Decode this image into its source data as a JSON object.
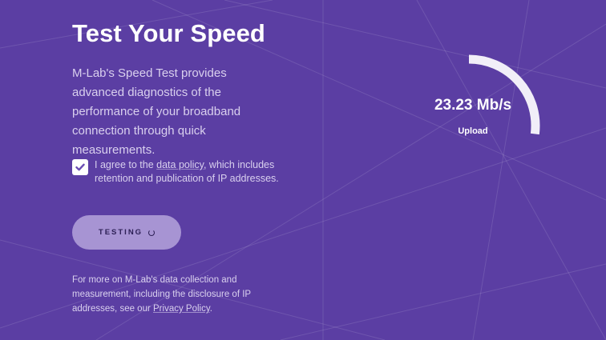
{
  "page": {
    "title": "Test Your Speed",
    "description": "M-Lab's Speed Test provides advanced diagnostics of the performance of your broadband connection through quick measurements."
  },
  "agreement": {
    "checked": true,
    "text_before": "I agree to the ",
    "link_text": "data policy",
    "text_after": ", which includes retention and publication of IP addresses."
  },
  "test_button": {
    "label": "TESTING"
  },
  "footer": {
    "text_before": "For more on M-Lab's data collection and measurement, including the disclosure of IP addresses, see our ",
    "link_text": "Privacy Policy",
    "text_after": "."
  },
  "result": {
    "speed": "23.23 Mb/s",
    "label": "Upload",
    "gauge_fraction": 0.27
  },
  "colors": {
    "background": "#5b3ea3",
    "button": "#a794d3",
    "text_muted": "#d9d0ee",
    "accent": "#ffffff"
  }
}
